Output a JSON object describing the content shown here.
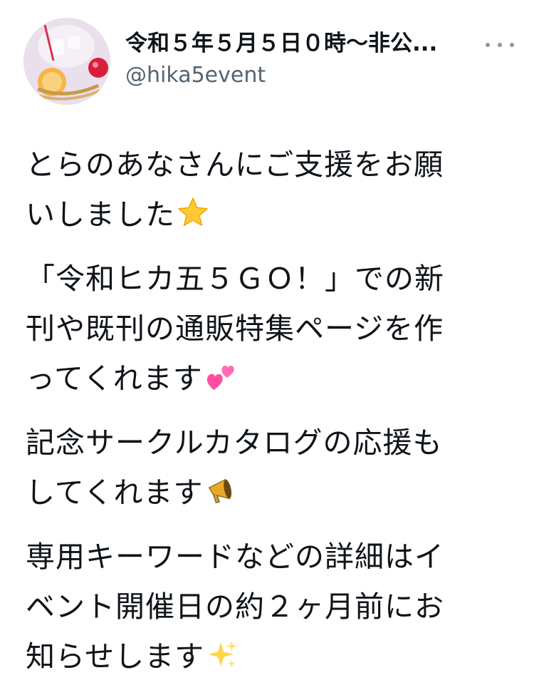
{
  "author": {
    "display_name": "令和５年５月５日０時〜非公...",
    "handle": "@hika5event",
    "avatar_icon": "avatar-drink-photo"
  },
  "more_icon": "more-horizontal-icon",
  "tweet": {
    "p1": {
      "line1": "とらのあなさんにご支援をお願",
      "line2": "いしました",
      "emoji": "star-emoji"
    },
    "p2": {
      "line1": "「令和ヒカ五５ＧＯ！」での新",
      "line2": "刊や既刊の通販特集ページを作",
      "line3": "ってくれます",
      "emoji": "two-hearts-emoji"
    },
    "p3": {
      "line1": "記念サークルカタログの応援も",
      "line2": "してくれます",
      "emoji": "megaphone-emoji"
    },
    "p4": {
      "line1": "専用キーワードなどの詳細はイ",
      "line2": "ベント開催日の約２ヶ月前にお",
      "line3": "知らせします",
      "emoji": "sparkles-emoji"
    }
  },
  "colors": {
    "text": "#0f1419",
    "secondary": "#536471",
    "dots": "#8b98a5"
  }
}
